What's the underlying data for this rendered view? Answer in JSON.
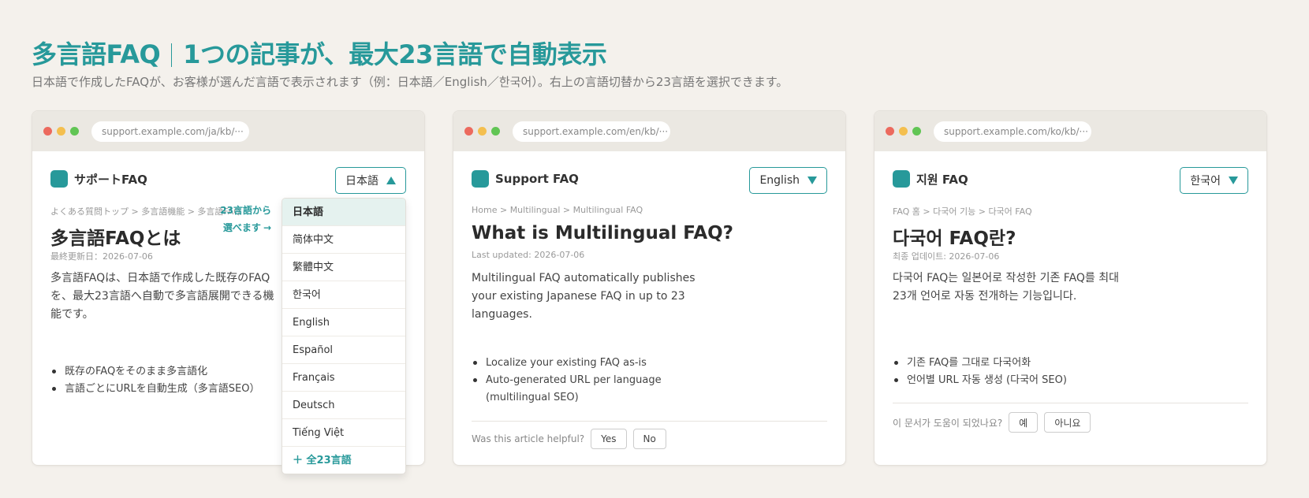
{
  "header": {
    "title_left": "多言語FAQ",
    "title_right": "1つの記事が、最大23言語で自動表示",
    "subtitle": "日本語で作成したFAQが、お客様が選んだ言語で表示されます（例：日本語／English／한국어）。右上の言語切替から23言語を選択できます。"
  },
  "accent_color": "#27999a",
  "windows": [
    {
      "url": "support.example.com/ja/kb/···",
      "brand": "サポートFAQ",
      "language": "日本語",
      "language_dropdown_state": "open",
      "breadcrumb": "よくある質問トップ > 多言語機能 > 多言語FAQ",
      "title": "多言語FAQとは",
      "updated": "最終更新日：2026-07-06",
      "body": "多言語FAQは、日本語で作成した既存のFAQを、最大23言語へ自動で多言語展開できる機能です。",
      "bullets": [
        "既存のFAQをそのまま多言語化",
        "言語ごとにURLを自動生成（多言語SEO）"
      ]
    },
    {
      "url": "support.example.com/en/kb/···",
      "brand": "Support FAQ",
      "language": "English",
      "language_dropdown_state": "closed",
      "breadcrumb": "Home > Multilingual > Multilingual FAQ",
      "title": "What is Multilingual FAQ?",
      "updated": "Last updated: 2026-07-06",
      "body": "Multilingual FAQ automatically publishes your existing Japanese FAQ in up to 23 languages.",
      "bullets": [
        "Localize your existing FAQ as-is",
        "Auto-generated URL per language (multilingual SEO)"
      ],
      "helpful_label": "Was this article helpful?",
      "yes_label": "Yes",
      "no_label": "No"
    },
    {
      "url": "support.example.com/ko/kb/···",
      "brand": "지원 FAQ",
      "language": "한국어",
      "language_dropdown_state": "closed",
      "breadcrumb": "FAQ 홈 > 다국어 기능 > 다국어 FAQ",
      "title": "다국어 FAQ란?",
      "updated": "최종 업데이트: 2026-07-06",
      "body": "다국어 FAQ는 일본어로 작성한 기존 FAQ를 최대 23개 언어로 자동 전개하는 기능입니다.",
      "bullets": [
        "기존 FAQ를 그대로 다국어화",
        "언어별 URL 자동 생성 (다국어 SEO)"
      ],
      "helpful_label": "이 문서가 도움이 되었나요?",
      "yes_label": "예",
      "no_label": "아니요"
    }
  ],
  "dropdown": {
    "options": [
      "日本語",
      "简体中文",
      "繁體中文",
      "한국어",
      "English",
      "Español",
      "Français",
      "Deutsch",
      "Tiếng Việt"
    ],
    "selected": "日本語",
    "more": "＋ 全23言語"
  },
  "annotation": {
    "line1": "23言語から",
    "line2": "選べます",
    "arrow": "→"
  }
}
